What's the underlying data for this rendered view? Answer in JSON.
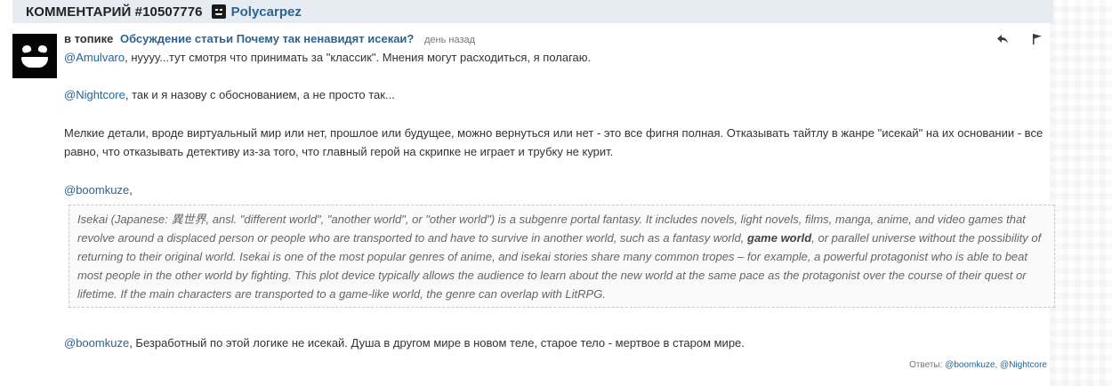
{
  "header": {
    "title": "КОММЕНТАРИЙ #10507776",
    "username": "Polycarpez"
  },
  "comment": {
    "in_topic_label": "в топике",
    "topic_link": "Обсуждение статьи Почему так ненавидят исекаи?",
    "time": "день назад",
    "paragraphs": {
      "p1_mention": "@Amulvaro",
      "p1_text": ", нуууу...тут смотря что принимать за \"классик\". Мнения могут расходиться, я полагаю.",
      "p2_mention": "@Nightcore",
      "p2_text": ", так и я назову с обоснованием, а не просто так...",
      "p3_text": "Мелкие детали, вроде виртуальный мир или нет, прошлое или будущее, можно вернуться или нет - это все фигня полная. Отказывать тайтлу в жанре \"исекай\" на их основании - все равно, что отказывать детективу из-за того, что главный герой на скрипке не играет и трубку не курит.",
      "p4_mention": "@boomkuze",
      "p4_text": ",",
      "p5_mention": "@boomkuze",
      "p5_text": ", Безработный по этой логике не исекай. Душа в другом мире в новом теле, старое тело - мертвое в старом мире."
    },
    "quote": {
      "part1": "Isekai (Japanese: 異世界, ansl. \"different world\", \"another world\", or \"other world\") is a subgenre portal fantasy. It includes novels, light novels, films, manga, anime, and video games that revolve around a displaced person or people who are transported to and have to survive in another world, such as a fantasy world, ",
      "bold": "game world",
      "part2": ", or parallel universe without the possibility of returning to their original world. Isekai is one of the most popular genres of anime, and isekai stories share many common tropes – for example, a powerful protagonist who is able to beat most people in the other world by fighting. This plot device typically allows the audience to learn about the new world at the same pace as the protagonist over the course of their quest or lifetime. If the main characters are transported to a game-like world, the genre can overlap with LitRPG."
    },
    "replies": {
      "label": "Ответы:",
      "users": [
        "@boomkuze",
        "@Nightcore"
      ],
      "separator": ","
    }
  },
  "icons": {
    "reply": "reply-arrow-icon",
    "flag": "flag-icon",
    "avatar": "grinning-face-avatar"
  },
  "colors": {
    "header_bg": "#e7ecf2",
    "link": "#2a6496",
    "quote_text": "#666666"
  }
}
